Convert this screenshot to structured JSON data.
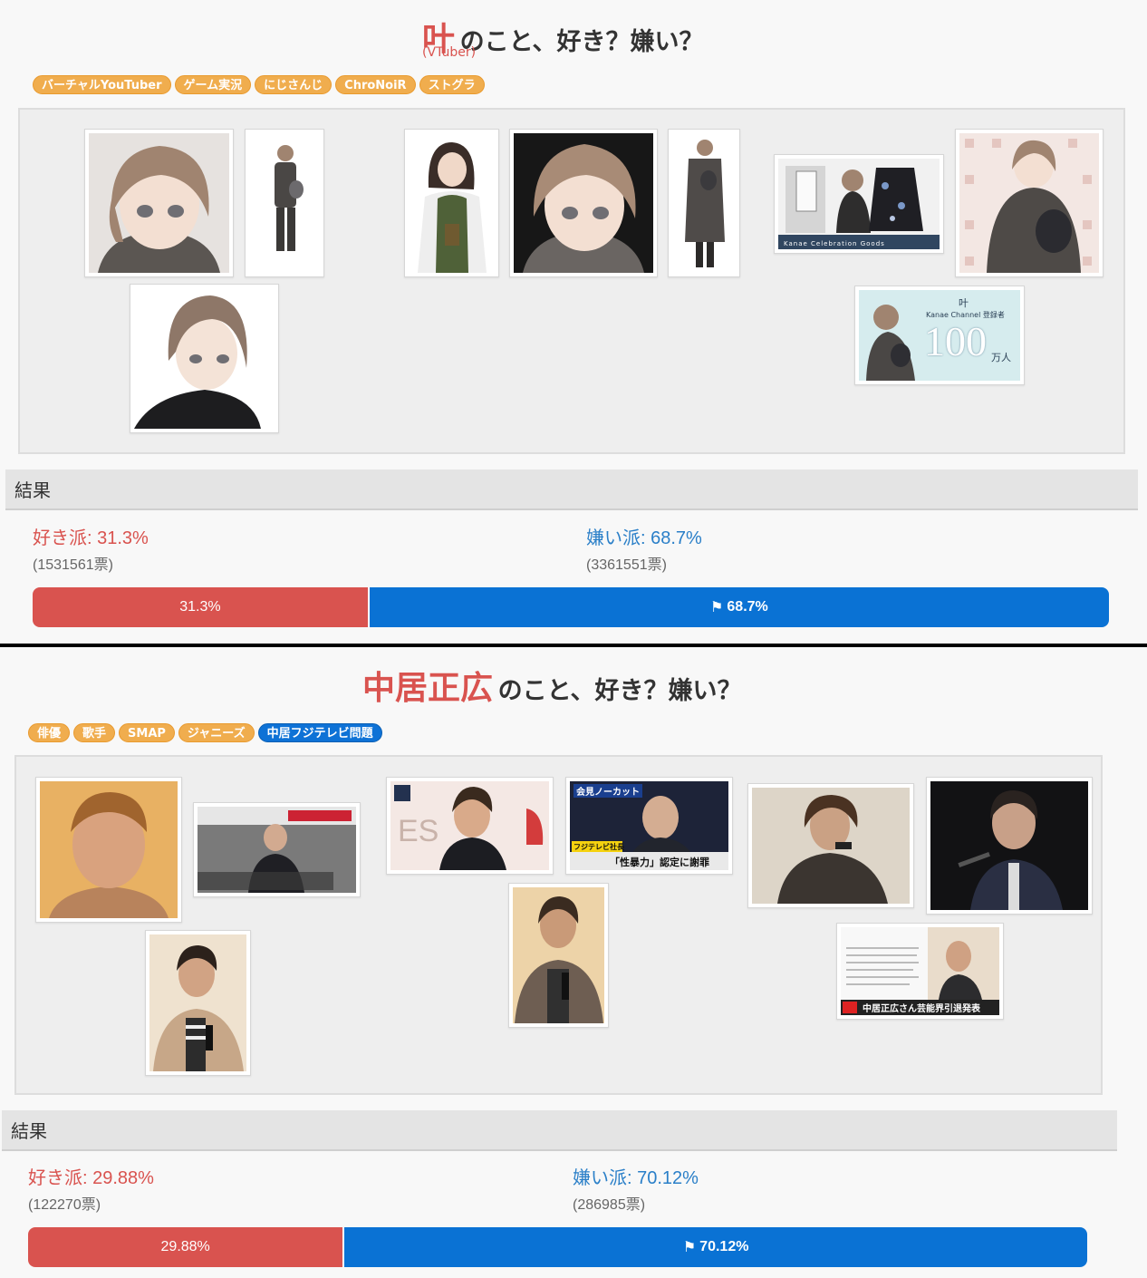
{
  "poll1": {
    "name": "叶",
    "title_rest": "のこと、好き？嫌い？",
    "subtitle": "(VTuber)",
    "tags": [
      {
        "label": "バーチャルYouTuber",
        "color": "#f0ad4e"
      },
      {
        "label": "ゲーム実況",
        "color": "#f0ad4e"
      },
      {
        "label": "にじさんじ",
        "color": "#f0ad4e"
      },
      {
        "label": "ChroNoiR",
        "color": "#f0ad4e"
      },
      {
        "label": "ストグラ",
        "color": "#f0ad4e"
      }
    ],
    "images": {
      "kanae_goods_text": "Kanae Celebration Goods",
      "kanae_100_title": "叶",
      "kanae_100_sub": "Kanae Channel 登録者",
      "kanae_100_num": "100",
      "kanae_100_unit": "万人"
    },
    "result_heading": "結果",
    "like_label": "好き派: 31.3%",
    "like_votes": "(1531561票)",
    "dislike_label": "嫌い派: 68.7%",
    "dislike_votes": "(3361551票)",
    "like_percent": 31.3,
    "like_bar_text": "31.3%",
    "dislike_bar_text": "68.7%",
    "flag_icon": "flag-checkered-icon"
  },
  "poll2": {
    "name": "中居正広",
    "title_rest": "のこと、好き？嫌い？",
    "tags": [
      {
        "label": "俳優",
        "color": "#f0ad4e"
      },
      {
        "label": "歌手",
        "color": "#f0ad4e"
      },
      {
        "label": "SMAP",
        "color": "#f0ad4e"
      },
      {
        "label": "ジャニーズ",
        "color": "#f0ad4e"
      },
      {
        "label": "中居フジテレビ問題",
        "color": "#0e72d6"
      }
    ],
    "images": {
      "news_caption": "会見ノーカット",
      "news_sub": "「性暴力」認定に謝罪",
      "news_badge": "フジテレビ社長",
      "retire_caption": "中居正広さん芸能界引退発表",
      "es_text": "ES"
    },
    "result_heading": "結果",
    "like_label": "好き派: 29.88%",
    "like_votes": "(122270票)",
    "dislike_label": "嫌い派: 70.12%",
    "dislike_votes": "(286985票)",
    "like_percent": 29.88,
    "like_bar_text": "29.88%",
    "dislike_bar_text": "70.12%",
    "flag_icon": "flag-checkered-icon"
  },
  "colors": {
    "like": "#d9534f",
    "dislike": "#0a72d4",
    "tag": "#f0ad4e",
    "tag_active": "#0e72d6"
  }
}
